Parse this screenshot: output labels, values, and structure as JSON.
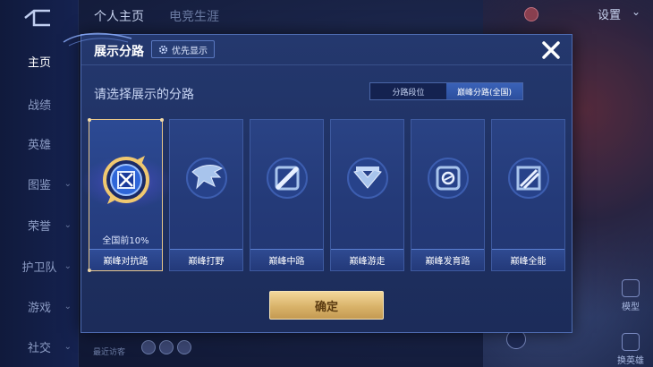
{
  "background": {
    "top_tabs": [
      "个人主页",
      "电竞生涯"
    ],
    "settings_label": "设置",
    "sidebar_items": [
      {
        "label": "主页",
        "active": true,
        "chevron": false
      },
      {
        "label": "战绩",
        "active": false,
        "chevron": false
      },
      {
        "label": "英雄",
        "active": false,
        "chevron": false
      },
      {
        "label": "图鉴",
        "active": false,
        "chevron": true
      },
      {
        "label": "荣誉",
        "active": false,
        "chevron": true
      },
      {
        "label": "护卫队",
        "active": false,
        "chevron": true
      },
      {
        "label": "游戏",
        "active": false,
        "chevron": true
      },
      {
        "label": "社交",
        "active": false,
        "chevron": true
      }
    ],
    "recent_visit_label": "最近访客",
    "model_label": "模型",
    "swap_hero_label": "换英雄"
  },
  "modal": {
    "title": "展示分路",
    "priority_label": "优先显示",
    "subtitle": "请选择展示的分路",
    "toggle": {
      "options": [
        "分路段位",
        "巅峰分路(全国)"
      ],
      "selected_index": 1
    },
    "cards": [
      {
        "label": "巅峰对抗路",
        "rank": "全国前10%",
        "selected": true,
        "icon": "sword-shield-emblem"
      },
      {
        "label": "巅峰打野",
        "rank": "",
        "selected": false,
        "icon": "beast-head-emblem"
      },
      {
        "label": "巅峰中路",
        "rank": "",
        "selected": false,
        "icon": "staff-emblem"
      },
      {
        "label": "巅峰游走",
        "rank": "",
        "selected": false,
        "icon": "wings-emblem"
      },
      {
        "label": "巅峰发育路",
        "rank": "",
        "selected": false,
        "icon": "target-emblem"
      },
      {
        "label": "巅峰全能",
        "rank": "",
        "selected": false,
        "icon": "hexagon-emblem"
      }
    ],
    "confirm_label": "确定"
  },
  "colors": {
    "accent_gold": "#e8c78a",
    "modal_bg": "#1f3163",
    "toggle_active": "#2c4f9e"
  }
}
